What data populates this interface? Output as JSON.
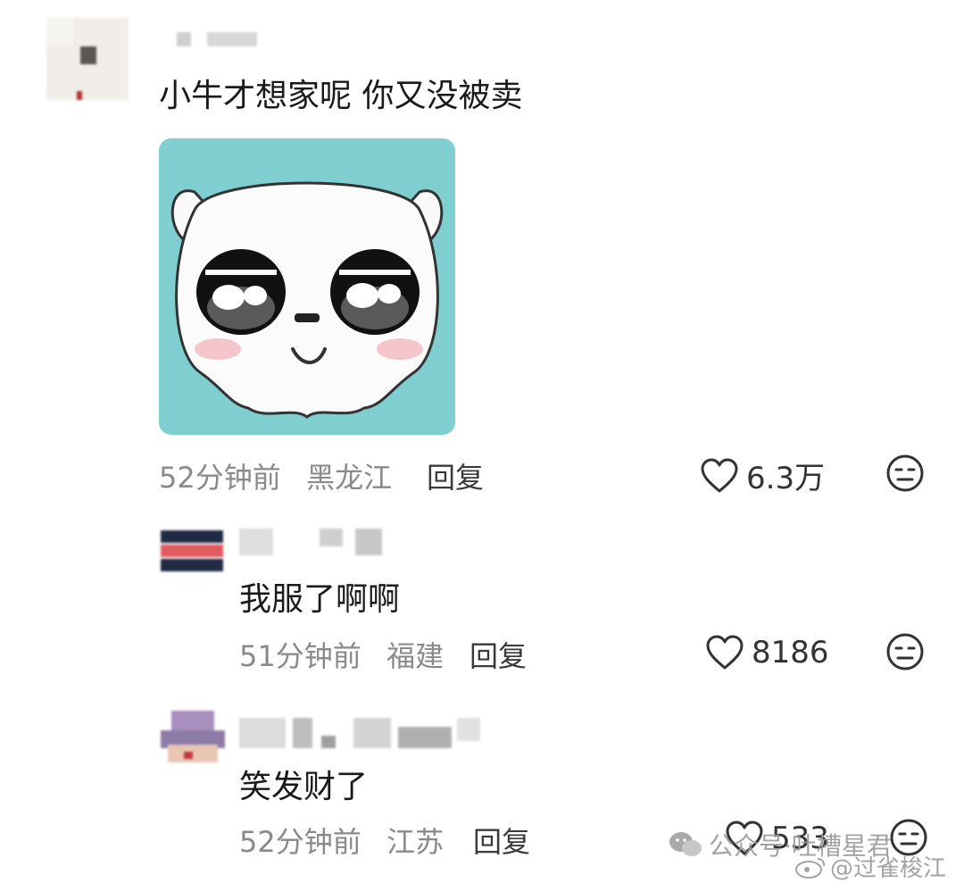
{
  "comments": [
    {
      "content": "小牛才想家呢 你又没被卖",
      "time": "52分钟前",
      "location": "黑龙江",
      "reply_label": "回复",
      "likes": "6.3万"
    },
    {
      "content": "我服了啊啊",
      "time": "51分钟前",
      "location": "福建",
      "reply_label": "回复",
      "likes": "8186"
    },
    {
      "content": "笑发财了",
      "time": "52分钟前",
      "location": "江苏",
      "reply_label": "回复",
      "likes": "533"
    }
  ],
  "watermark": {
    "wechat": "公众号·吐槽星君",
    "weibo": "@过雀梭江"
  },
  "colors": {
    "sticker_bg": "#7fcfcf",
    "meta_text": "#8a8a8a"
  }
}
